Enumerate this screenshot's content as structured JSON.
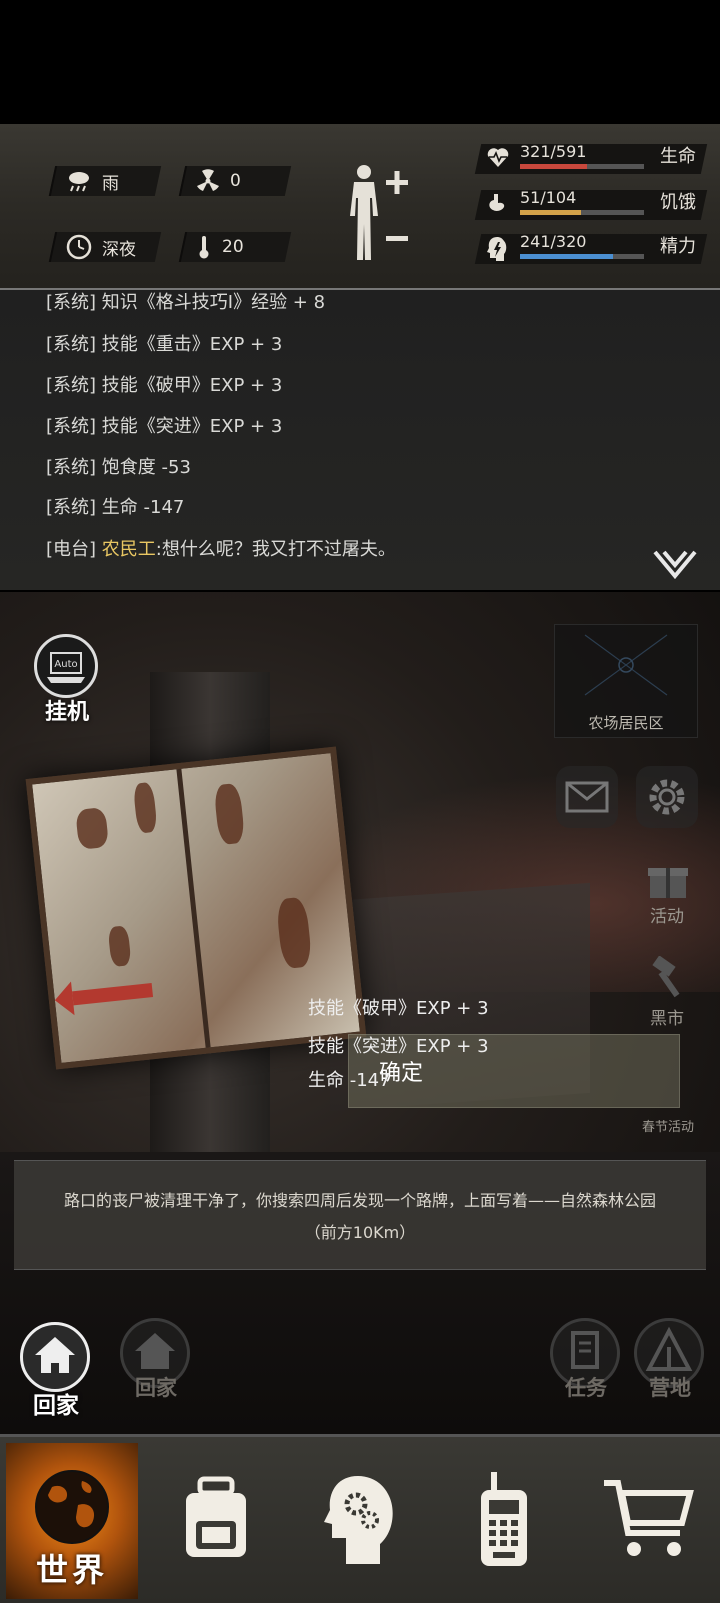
{
  "status": {
    "weather": "雨",
    "radiation": "0",
    "time_of_day": "深夜",
    "temperature": "20",
    "health": {
      "value": "321/591",
      "label": "生命",
      "ratio": 0.543,
      "color": "#c9483c"
    },
    "hunger": {
      "value": "51/104",
      "label": "饥饿",
      "ratio": 0.49,
      "color": "#d4a34a"
    },
    "energy": {
      "value": "241/320",
      "label": "精力",
      "ratio": 0.753,
      "color": "#4b8fd1"
    }
  },
  "log": [
    {
      "tag": "[系统]",
      "text": "知识《格斗技巧Ⅰ》经验 + 8"
    },
    {
      "tag": "[系统]",
      "text": "技能《重击》EXP + 3"
    },
    {
      "tag": "[系统]",
      "text": "技能《破甲》EXP + 3"
    },
    {
      "tag": "[系统]",
      "text": "技能《突进》EXP + 3"
    },
    {
      "tag": "[系统]",
      "text": "饱食度 -53"
    },
    {
      "tag": "[系统]",
      "text": "生命 -147"
    },
    {
      "tag": "[电台]",
      "speaker": "农民工",
      "text": ":想什么呢？我又打不过屠夫。"
    }
  ],
  "scene": {
    "auto_badge": "Auto",
    "auto_label": "挂机",
    "location": "农场居民区",
    "side_activity": "活动",
    "side_black_market": "黑市",
    "side_festival": "春节活动",
    "floating_lines": [
      "技能《破甲》EXP + 3",
      "技能《突进》EXP + 3",
      "生命 -147"
    ],
    "confirm_label": "确定",
    "narrative": "路口的丧尸被清理干净了，你搜索四周后发现一个路牌，上面写着——自然森林公园（前方10Km）",
    "home_label": "回家",
    "home2_label": "回家",
    "task_label": "任务",
    "camp_label": "营地"
  },
  "nav": {
    "world": "世界",
    "items": [
      "backpack-icon",
      "skills-head-icon",
      "radio-icon",
      "cart-icon"
    ]
  }
}
